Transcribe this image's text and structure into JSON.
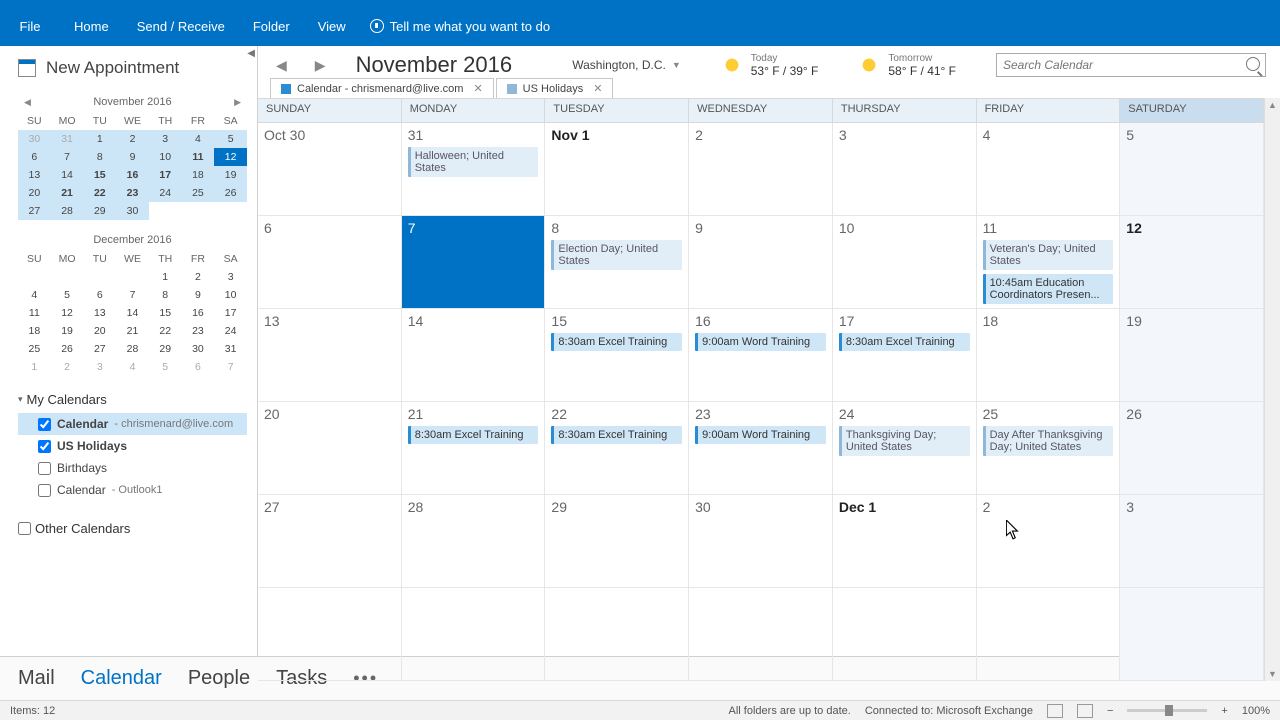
{
  "ribbon": {
    "file": "File",
    "tabs": [
      "Home",
      "Send / Receive",
      "Folder",
      "View"
    ],
    "tellme": "Tell me what you want to do"
  },
  "sidebar": {
    "new_appt": "New Appointment",
    "mini1": {
      "title": "November 2016",
      "dow": [
        "SU",
        "MO",
        "TU",
        "WE",
        "TH",
        "FR",
        "SA"
      ],
      "days": [
        {
          "n": "30",
          "c": "dim hl"
        },
        {
          "n": "31",
          "c": "dim hl"
        },
        {
          "n": "1",
          "c": "hl"
        },
        {
          "n": "2",
          "c": "hl"
        },
        {
          "n": "3",
          "c": "hl"
        },
        {
          "n": "4",
          "c": "hl"
        },
        {
          "n": "5",
          "c": "hl"
        },
        {
          "n": "6",
          "c": "hl"
        },
        {
          "n": "7",
          "c": "hl"
        },
        {
          "n": "8",
          "c": "hl"
        },
        {
          "n": "9",
          "c": "hl"
        },
        {
          "n": "10",
          "c": "hl"
        },
        {
          "n": "11",
          "c": "hl bold"
        },
        {
          "n": "12",
          "c": "tdy"
        },
        {
          "n": "13",
          "c": "hl"
        },
        {
          "n": "14",
          "c": "hl"
        },
        {
          "n": "15",
          "c": "hl bold"
        },
        {
          "n": "16",
          "c": "hl bold"
        },
        {
          "n": "17",
          "c": "hl bold"
        },
        {
          "n": "18",
          "c": "hl"
        },
        {
          "n": "19",
          "c": "hl"
        },
        {
          "n": "20",
          "c": "hl"
        },
        {
          "n": "21",
          "c": "hl bold"
        },
        {
          "n": "22",
          "c": "hl bold"
        },
        {
          "n": "23",
          "c": "hl bold"
        },
        {
          "n": "24",
          "c": "hl"
        },
        {
          "n": "25",
          "c": "hl"
        },
        {
          "n": "26",
          "c": "hl"
        },
        {
          "n": "27",
          "c": "hl"
        },
        {
          "n": "28",
          "c": "hl"
        },
        {
          "n": "29",
          "c": "hl"
        },
        {
          "n": "30",
          "c": "hl"
        },
        {
          "n": "",
          "c": ""
        },
        {
          "n": "",
          "c": ""
        },
        {
          "n": "",
          "c": ""
        }
      ]
    },
    "mini2": {
      "title": "December 2016",
      "dow": [
        "SU",
        "MO",
        "TU",
        "WE",
        "TH",
        "FR",
        "SA"
      ],
      "days": [
        {
          "n": "",
          "c": ""
        },
        {
          "n": "",
          "c": ""
        },
        {
          "n": "",
          "c": ""
        },
        {
          "n": "",
          "c": ""
        },
        {
          "n": "1",
          "c": ""
        },
        {
          "n": "2",
          "c": ""
        },
        {
          "n": "3",
          "c": ""
        },
        {
          "n": "4",
          "c": ""
        },
        {
          "n": "5",
          "c": ""
        },
        {
          "n": "6",
          "c": ""
        },
        {
          "n": "7",
          "c": ""
        },
        {
          "n": "8",
          "c": ""
        },
        {
          "n": "9",
          "c": ""
        },
        {
          "n": "10",
          "c": ""
        },
        {
          "n": "11",
          "c": ""
        },
        {
          "n": "12",
          "c": ""
        },
        {
          "n": "13",
          "c": ""
        },
        {
          "n": "14",
          "c": ""
        },
        {
          "n": "15",
          "c": ""
        },
        {
          "n": "16",
          "c": ""
        },
        {
          "n": "17",
          "c": ""
        },
        {
          "n": "18",
          "c": ""
        },
        {
          "n": "19",
          "c": ""
        },
        {
          "n": "20",
          "c": ""
        },
        {
          "n": "21",
          "c": ""
        },
        {
          "n": "22",
          "c": ""
        },
        {
          "n": "23",
          "c": ""
        },
        {
          "n": "24",
          "c": ""
        },
        {
          "n": "25",
          "c": ""
        },
        {
          "n": "26",
          "c": ""
        },
        {
          "n": "27",
          "c": ""
        },
        {
          "n": "28",
          "c": ""
        },
        {
          "n": "29",
          "c": ""
        },
        {
          "n": "30",
          "c": ""
        },
        {
          "n": "31",
          "c": ""
        },
        {
          "n": "1",
          "c": "dim"
        },
        {
          "n": "2",
          "c": "dim"
        },
        {
          "n": "3",
          "c": "dim"
        },
        {
          "n": "4",
          "c": "dim"
        },
        {
          "n": "5",
          "c": "dim"
        },
        {
          "n": "6",
          "c": "dim"
        },
        {
          "n": "7",
          "c": "dim"
        }
      ]
    },
    "my_calendars": "My Calendars",
    "cal_items": [
      {
        "name": "Calendar",
        "sub": " - chrismenard@live.com",
        "checked": true,
        "sel": true
      },
      {
        "name": "US Holidays",
        "sub": "",
        "checked": true,
        "sel": false,
        "bold": true
      },
      {
        "name": "Birthdays",
        "sub": "",
        "checked": false,
        "sel": false
      },
      {
        "name": "Calendar",
        "sub": " - Outlook1",
        "checked": false,
        "sel": false
      }
    ],
    "other_calendars": "Other Calendars"
  },
  "header": {
    "title": "November 2016",
    "location": "Washington,  D.C.",
    "today_lbl": "Today",
    "today_temp": "53° F / 39° F",
    "tomorrow_lbl": "Tomorrow",
    "tomorrow_temp": "58° F / 41° F",
    "search_placeholder": "Search Calendar"
  },
  "tabs": [
    {
      "color": "#2a8dd4",
      "label": "Calendar - chrismenard@live.com"
    },
    {
      "color": "#8fb8d8",
      "label": "US Holidays"
    }
  ],
  "cols": [
    "SUNDAY",
    "MONDAY",
    "TUESDAY",
    "WEDNESDAY",
    "THURSDAY",
    "FRIDAY",
    "SATURDAY"
  ],
  "weeks": [
    [
      {
        "d": "Oct 30"
      },
      {
        "d": "31",
        "ev": [
          {
            "t": "Halloween; United States",
            "k": "hol"
          }
        ]
      },
      {
        "d": "Nov 1",
        "bold": true
      },
      {
        "d": "2"
      },
      {
        "d": "3"
      },
      {
        "d": "4"
      },
      {
        "d": "5",
        "sat": true
      }
    ],
    [
      {
        "d": "6"
      },
      {
        "d": "7",
        "sel": true
      },
      {
        "d": "8",
        "ev": [
          {
            "t": "Election Day; United States",
            "k": "hol"
          }
        ]
      },
      {
        "d": "9"
      },
      {
        "d": "10"
      },
      {
        "d": "11",
        "ev": [
          {
            "t": "Veteran's Day; United States",
            "k": "hol"
          },
          {
            "t": "10:45am Education Coordinators Presen...",
            "k": "trn"
          }
        ]
      },
      {
        "d": "12",
        "sat": true,
        "bold": true
      }
    ],
    [
      {
        "d": "13"
      },
      {
        "d": "14"
      },
      {
        "d": "15",
        "ev": [
          {
            "t": "8:30am Excel Training",
            "k": "trn"
          }
        ]
      },
      {
        "d": "16",
        "ev": [
          {
            "t": "9:00am Word Training",
            "k": "trn"
          }
        ]
      },
      {
        "d": "17",
        "ev": [
          {
            "t": "8:30am Excel Training",
            "k": "trn"
          }
        ]
      },
      {
        "d": "18"
      },
      {
        "d": "19",
        "sat": true
      }
    ],
    [
      {
        "d": "20"
      },
      {
        "d": "21",
        "ev": [
          {
            "t": "8:30am Excel Training",
            "k": "trn"
          }
        ]
      },
      {
        "d": "22",
        "ev": [
          {
            "t": "8:30am Excel Training",
            "k": "trn"
          }
        ]
      },
      {
        "d": "23",
        "ev": [
          {
            "t": "9:00am Word Training",
            "k": "trn"
          }
        ]
      },
      {
        "d": "24",
        "ev": [
          {
            "t": "Thanksgiving Day; United States",
            "k": "hol"
          }
        ]
      },
      {
        "d": "25",
        "ev": [
          {
            "t": "Day After Thanksgiving Day; United States",
            "k": "hol"
          }
        ]
      },
      {
        "d": "26",
        "sat": true
      }
    ],
    [
      {
        "d": "27"
      },
      {
        "d": "28"
      },
      {
        "d": "29"
      },
      {
        "d": "30"
      },
      {
        "d": "Dec 1",
        "bold": true
      },
      {
        "d": "2"
      },
      {
        "d": "3",
        "sat": true
      }
    ],
    [
      {
        "d": ""
      },
      {
        "d": ""
      },
      {
        "d": ""
      },
      {
        "d": ""
      },
      {
        "d": ""
      },
      {
        "d": ""
      },
      {
        "d": "",
        "sat": true
      }
    ]
  ],
  "bottom": {
    "mail": "Mail",
    "calendar": "Calendar",
    "people": "People",
    "tasks": "Tasks"
  },
  "status": {
    "items": "Items: 12",
    "sync": "All folders are up to date.",
    "conn": "Connected to: Microsoft Exchange",
    "zoom": "100%"
  }
}
